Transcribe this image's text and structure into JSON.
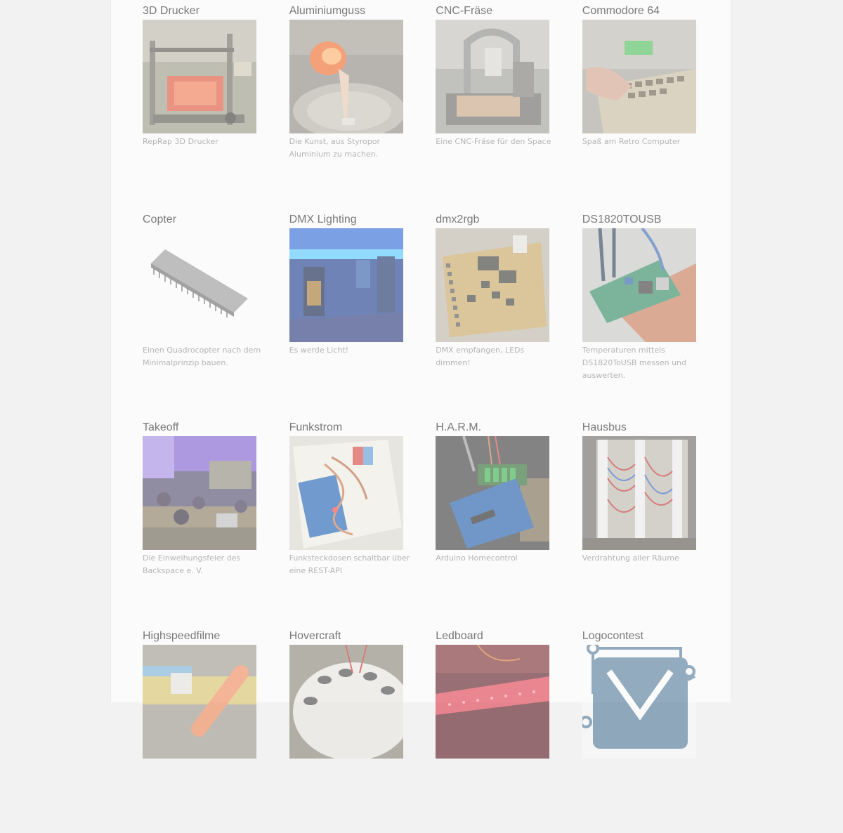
{
  "projects": [
    {
      "title": "3D Drucker",
      "description": "RepRap 3D Drucker",
      "thumb_icon": "reprap-printer-photo"
    },
    {
      "title": "Aluminiumguss",
      "description": "Die Kunst, aus Styropor Aluminium zu machen.",
      "thumb_icon": "aluminium-casting-photo"
    },
    {
      "title": "CNC-Fräse",
      "description": "Eine CNC-Fräse für den Space",
      "thumb_icon": "cnc-mill-photo"
    },
    {
      "title": "Commodore 64",
      "description": "Spaß am Retro Computer",
      "thumb_icon": "commodore-keyboard-photo"
    },
    {
      "title": "Copter",
      "description": "Einen Quadrocopter nach dem Minimalprinzip bauen.",
      "thumb_icon": "dip-chip-image"
    },
    {
      "title": "DMX Lighting",
      "description": "Es werde Licht!",
      "thumb_icon": "blue-lit-room-photo"
    },
    {
      "title": "dmx2rgb",
      "description": "DMX empfangen, LEDs dimmen!",
      "thumb_icon": "led-pcb-photo"
    },
    {
      "title": "DS1820TOUSB",
      "description": "Temperaturen mittels DS1820ToUSB messen und auswerten.",
      "thumb_icon": "usb-sensor-board-photo"
    },
    {
      "title": "Takeoff",
      "description": "Die Einweihungsfeier des Backspace e. V.",
      "thumb_icon": "party-room-photo"
    },
    {
      "title": "Funkstrom",
      "description": "Funksteckdosen schaltbar über eine REST-API",
      "thumb_icon": "arduino-box-photo"
    },
    {
      "title": "H.A.R.M.",
      "description": "Arduino Homecontrol",
      "thumb_icon": "arduino-board-photo"
    },
    {
      "title": "Hausbus",
      "description": "Verdrahtung aller Räume",
      "thumb_icon": "wiring-panel-photo"
    },
    {
      "title": "Highspeedfilme",
      "description": "",
      "thumb_icon": "highspeed-film-photo"
    },
    {
      "title": "Hovercraft",
      "description": "",
      "thumb_icon": "hovercraft-photo"
    },
    {
      "title": "Ledboard",
      "description": "",
      "thumb_icon": "ledboard-photo"
    },
    {
      "title": "Logocontest",
      "description": "",
      "thumb_icon": "logo-envelope-icon"
    }
  ]
}
